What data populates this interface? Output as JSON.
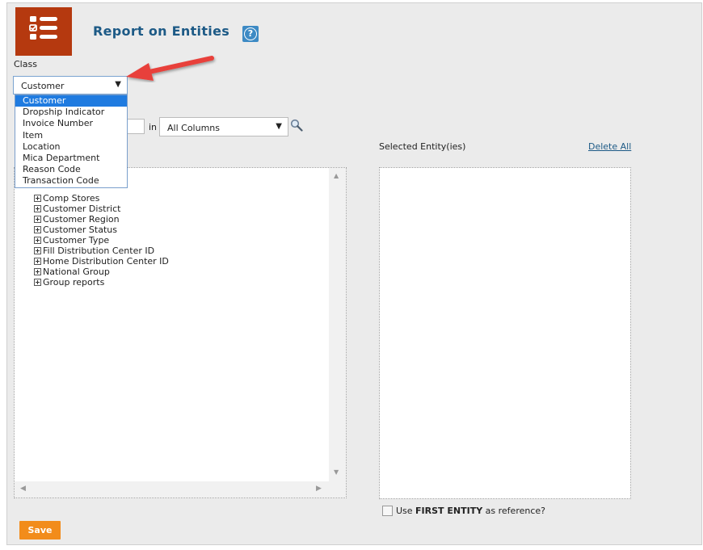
{
  "header": {
    "title": "Report on Entities",
    "help_glyph": "?"
  },
  "class_field": {
    "label": "Class",
    "selected": "Customer",
    "options": [
      "Customer",
      "Dropship Indicator",
      "Invoice Number",
      "Item",
      "Location",
      "Mica Department",
      "Reason Code",
      "Transaction Code"
    ]
  },
  "search": {
    "in_label": "in",
    "column_select": "All Columns"
  },
  "selected_panel": {
    "label": "Selected Entity(ies)",
    "delete_all": "Delete All",
    "first_entity_prefix": "Use ",
    "first_entity_bold": "FIRST ENTITY",
    "first_entity_suffix": " as reference?"
  },
  "tree": {
    "items": [
      "Comp Stores",
      "Customer District",
      "Customer Region",
      "Customer Status",
      "Customer Type",
      "Fill Distribution Center ID",
      "Home Distribution Center ID",
      "National Group",
      "Group reports"
    ]
  },
  "footer": {
    "save_label": "Save"
  },
  "colors": {
    "brand_orange": "#b5390f",
    "title_blue": "#1d5a86",
    "save_orange": "#f28c1b",
    "selected_option": "#1f7be0",
    "annotation_arrow": "#e8413a"
  },
  "icons": {
    "app": "checklist-icon",
    "help": "help-icon",
    "search": "magnifier-icon"
  }
}
